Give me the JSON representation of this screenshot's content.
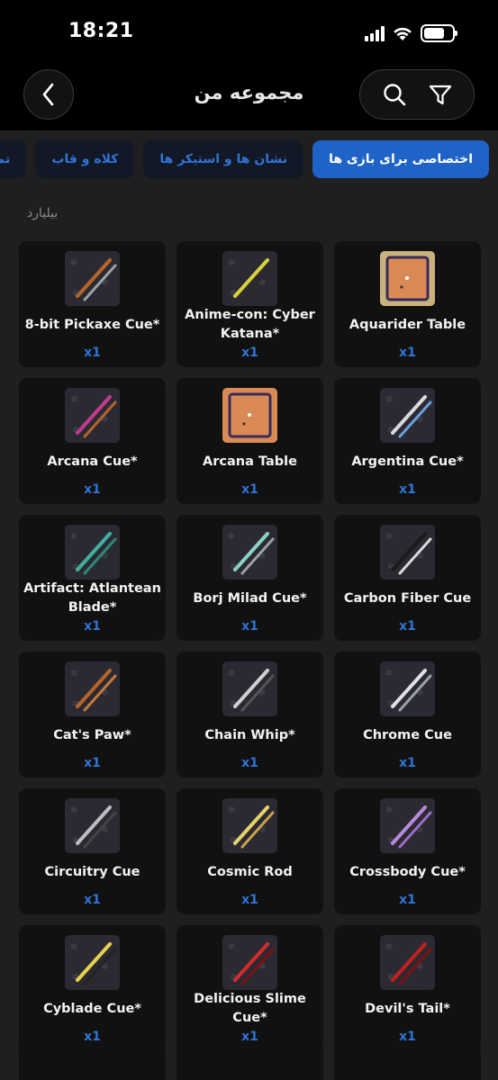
{
  "status_bar": {
    "time": "18:21"
  },
  "header": {
    "title": "مجموعه من"
  },
  "tabs": [
    {
      "label": "اختصاصی برای بازی ها",
      "active": true
    },
    {
      "label": "نشان ها و استیکر ها",
      "active": false
    },
    {
      "label": "کلاه و قاب",
      "active": false
    },
    {
      "label": "تم چت",
      "active": false
    }
  ],
  "section": {
    "label": "بیلیارد"
  },
  "colors": {
    "accent": "#1f63c7",
    "quantity": "#2f74d6",
    "card_bg": "#111112",
    "page_bg": "#1f1f21"
  },
  "items": [
    {
      "name": "8-bit Pickaxe Cue*",
      "qty": "x1",
      "icon": "pickaxe-cue-icon"
    },
    {
      "name": "Anime-con: Cyber Katana*",
      "qty": "x1",
      "icon": "katana-cue-icon"
    },
    {
      "name": "Aquarider Table",
      "qty": "x1",
      "icon": "aquarider-table-icon"
    },
    {
      "name": "Arcana Cue*",
      "qty": "x1",
      "icon": "arcana-cue-icon"
    },
    {
      "name": "Arcana Table",
      "qty": "x1",
      "icon": "arcana-table-icon"
    },
    {
      "name": "Argentina Cue*",
      "qty": "x1",
      "icon": "argentina-cue-icon"
    },
    {
      "name": "Artifact: Atlantean Blade*",
      "qty": "x1",
      "icon": "atlantean-blade-icon"
    },
    {
      "name": "Borj Milad Cue*",
      "qty": "x1",
      "icon": "borj-milad-cue-icon"
    },
    {
      "name": "Carbon Fiber Cue",
      "qty": "x1",
      "icon": "carbon-fiber-cue-icon"
    },
    {
      "name": "Cat's Paw*",
      "qty": "x1",
      "icon": "cats-paw-cue-icon"
    },
    {
      "name": "Chain Whip*",
      "qty": "x1",
      "icon": "chain-whip-cue-icon"
    },
    {
      "name": "Chrome Cue",
      "qty": "x1",
      "icon": "chrome-cue-icon"
    },
    {
      "name": "Circuitry Cue",
      "qty": "x1",
      "icon": "circuitry-cue-icon"
    },
    {
      "name": "Cosmic Rod",
      "qty": "x1",
      "icon": "cosmic-rod-icon"
    },
    {
      "name": "Crossbody Cue*",
      "qty": "x1",
      "icon": "crossbody-cue-icon"
    },
    {
      "name": "Cyblade Cue*",
      "qty": "x1",
      "icon": "cyblade-cue-icon"
    },
    {
      "name": "Delicious Slime Cue*",
      "qty": "x1",
      "icon": "slime-cue-icon"
    },
    {
      "name": "Devil's Tail*",
      "qty": "x1",
      "icon": "devils-tail-cue-icon"
    }
  ]
}
